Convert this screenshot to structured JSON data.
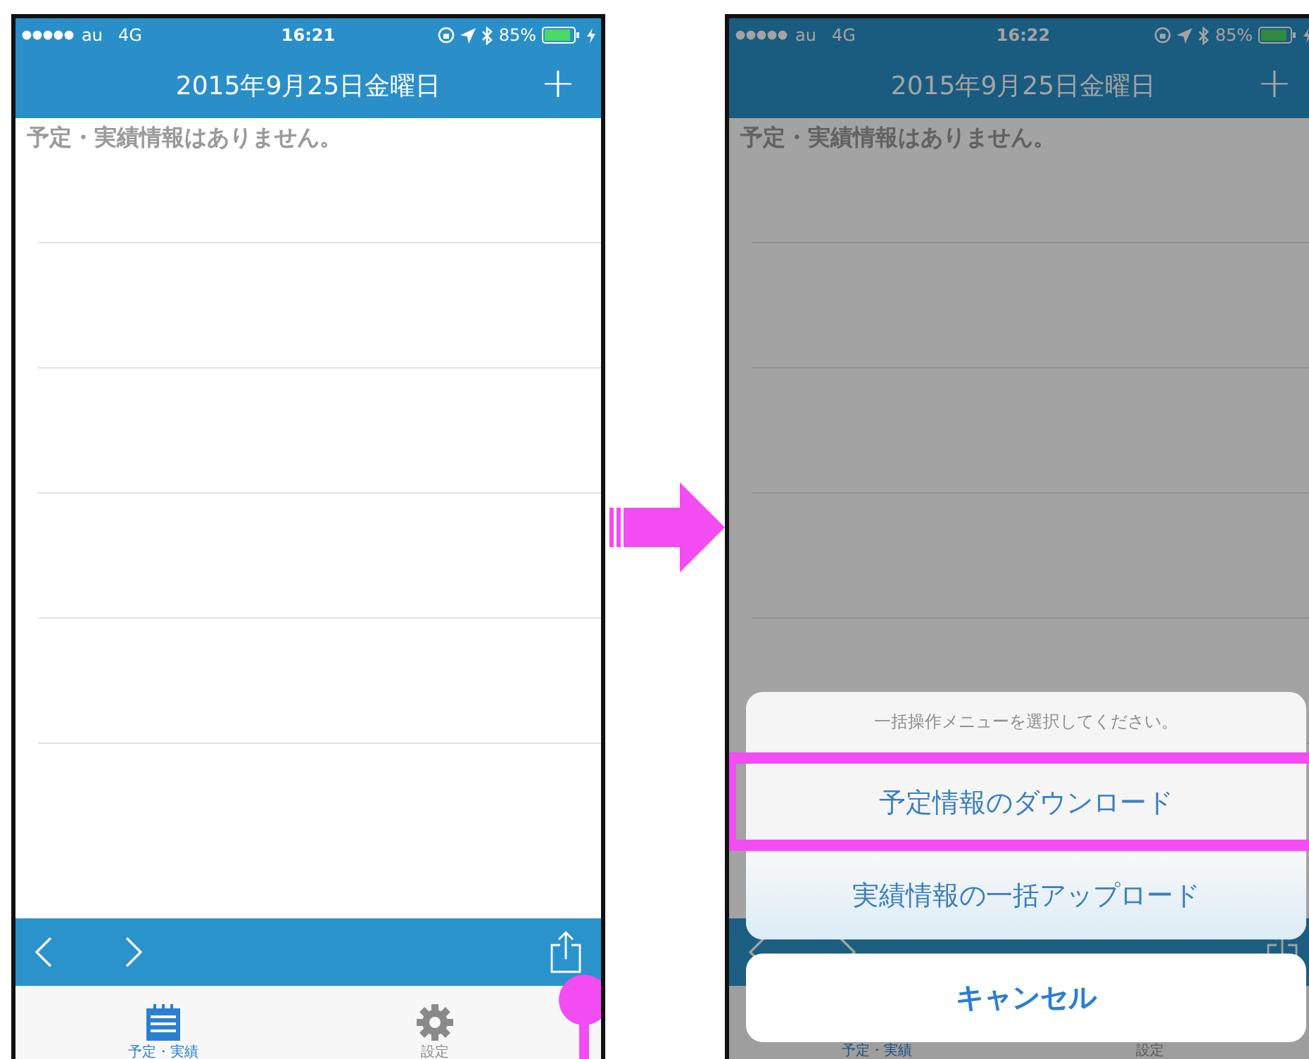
{
  "screens": [
    {
      "status_bar": {
        "carrier": "au",
        "network": "4G",
        "time": "16:21",
        "battery": "85%",
        "charging": true
      },
      "nav_bar": {
        "title": "2015年9月25日金曜日",
        "add": "+"
      },
      "empty_message": "予定・実績情報はありません。",
      "toolbar": {
        "share_tapped": true
      },
      "tabs": [
        {
          "label": "予定・実績",
          "selected": true
        },
        {
          "label": "設定",
          "selected": false
        }
      ],
      "dimmed": false
    },
    {
      "status_bar": {
        "carrier": "au",
        "network": "4G",
        "time": "16:22",
        "battery": "85%",
        "charging": true
      },
      "nav_bar": {
        "title": "2015年9月25日金曜日",
        "add": "+"
      },
      "empty_message": "予定・実績情報はありません。",
      "toolbar": {
        "share_tapped": false
      },
      "tabs": [
        {
          "label": "予定・実績",
          "selected": true
        },
        {
          "label": "設定",
          "selected": false
        }
      ],
      "dimmed": true,
      "action_sheet": {
        "title": "一括操作メニューを選択してください。",
        "options": [
          {
            "label": "予定情報のダウンロード",
            "highlighted": true
          },
          {
            "label": "実績情報の一括アップロード",
            "highlighted": false
          }
        ],
        "cancel": "キャンセル"
      }
    }
  ]
}
